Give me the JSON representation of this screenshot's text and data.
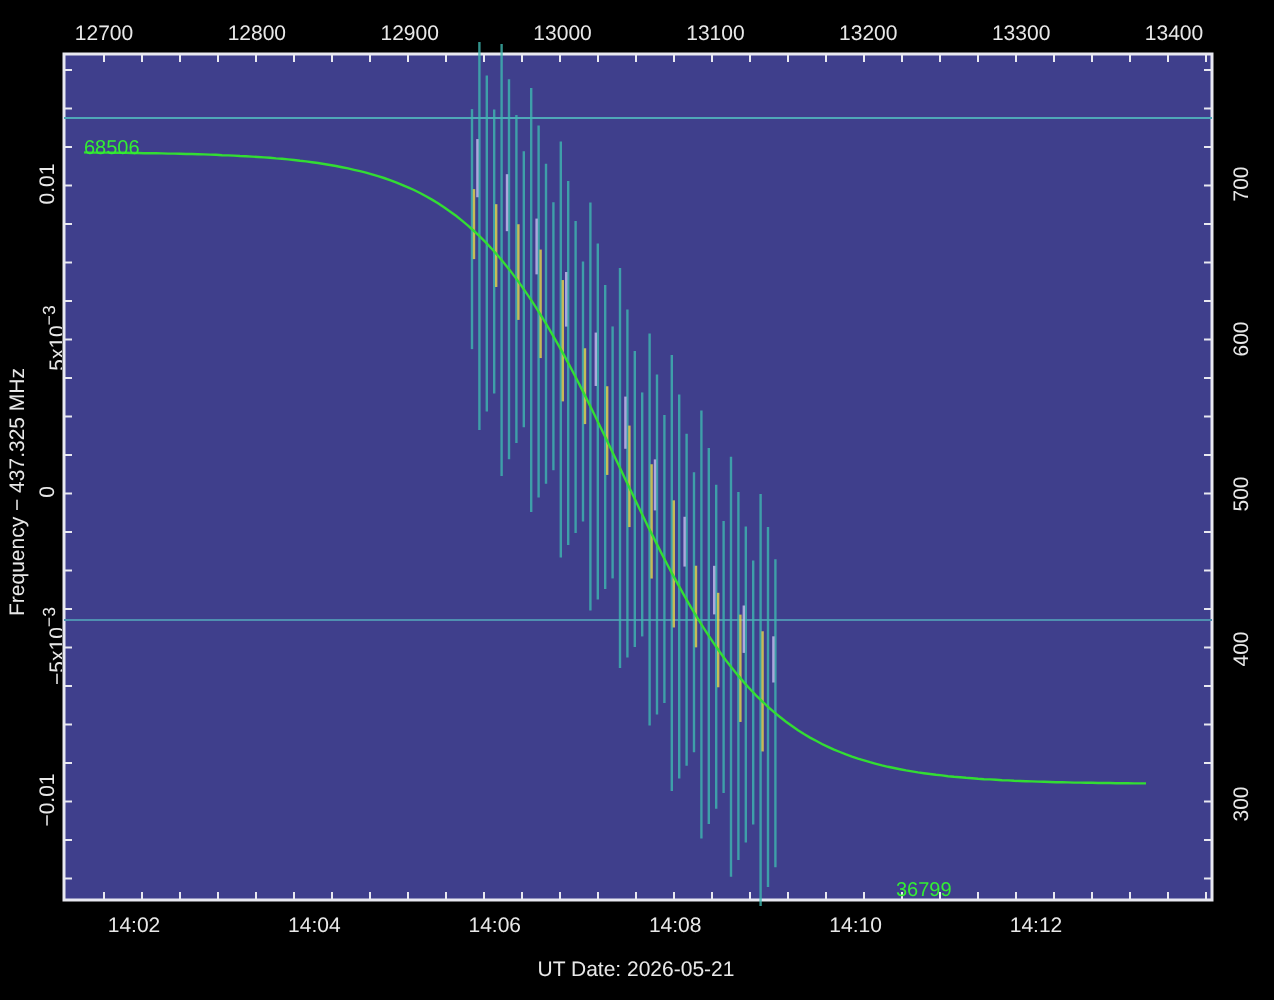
{
  "plot": {
    "top_axis": {
      "ticks": [
        "12700",
        "12800",
        "12900",
        "13000",
        "13100",
        "13200",
        "13300",
        "13400"
      ]
    },
    "left_axis": {
      "label": "Frequency − 437.325 MHz",
      "ticks": [
        "0.01",
        "5x10$^{−3}$",
        "0",
        "−5x10$^{−3}$",
        "−0.01"
      ]
    },
    "right_axis": {
      "ticks": [
        "700",
        "600",
        "500",
        "400",
        "300"
      ]
    },
    "bottom_axis": {
      "label": "UT Date: 2026-05-21",
      "ticks": [
        "14:02",
        "14:04",
        "14:06",
        "14:08",
        "14:10",
        "14:12"
      ]
    },
    "trace_labels": {
      "start": "68506",
      "end": "36799"
    }
  }
}
